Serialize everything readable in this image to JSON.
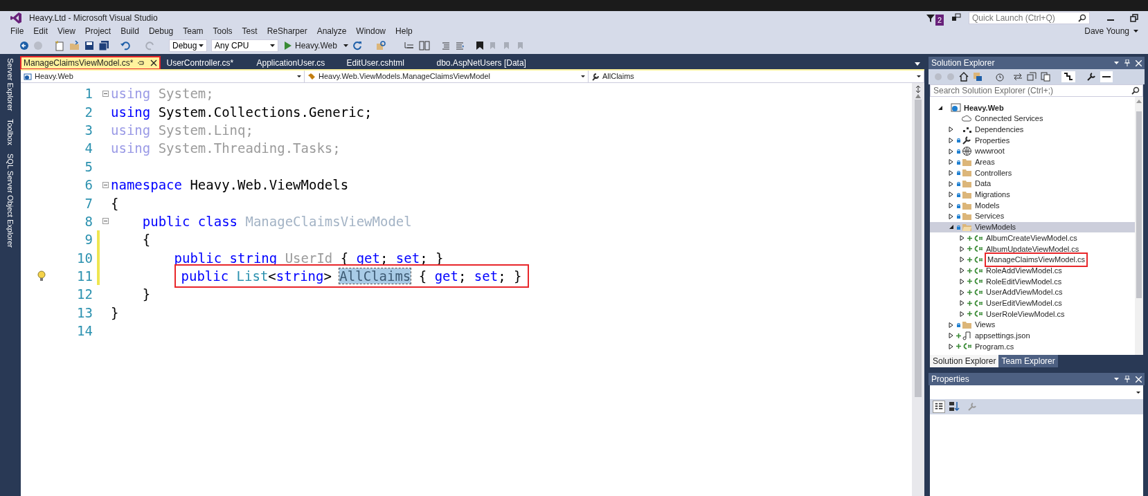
{
  "window": {
    "title": "Heavy.Ltd - Microsoft Visual Studio",
    "notification_count": "2",
    "quick_launch": {
      "placeholder": "Quick Launch (Ctrl+Q)"
    },
    "user": "Dave Young"
  },
  "menu": [
    "File",
    "Edit",
    "View",
    "Project",
    "Build",
    "Debug",
    "Team",
    "Tools",
    "Test",
    "ReSharper",
    "Analyze",
    "Window",
    "Help"
  ],
  "toolbar": {
    "configuration": "Debug",
    "platform": "Any CPU",
    "start": "Heavy.Web"
  },
  "side_tabs": [
    "Server Explorer",
    "Toolbox",
    "SQL Server Object Explorer"
  ],
  "tabs": [
    {
      "label": "ManageClaimsViewModel.cs*",
      "selected": true,
      "boxed": true
    },
    {
      "label": "UserController.cs*",
      "selected": false,
      "boxed": false
    },
    {
      "label": "ApplicationUser.cs",
      "selected": false,
      "boxed": false
    },
    {
      "label": "EditUser.cshtml",
      "selected": false,
      "boxed": false
    },
    {
      "label": "dbo.AspNetUsers [Data]",
      "selected": false,
      "boxed": false
    }
  ],
  "navigation": [
    "Heavy.Web",
    "Heavy.Web.ViewModels.ManageClaimsViewModel",
    "AllClaims"
  ],
  "code_lines": [
    {
      "number": "1",
      "collapsible": true,
      "changed": false,
      "lightbulb": false,
      "boxed": false,
      "tokens": [
        {
          "kind": "keyword-faded",
          "text": "using"
        },
        {
          "kind": "faded",
          "text": " System;"
        }
      ]
    },
    {
      "number": "2",
      "collapsible": false,
      "changed": false,
      "lightbulb": false,
      "boxed": false,
      "tokens": [
        {
          "kind": "keyword",
          "text": "using"
        },
        {
          "kind": "plain",
          "text": " System.Collections.Generic;"
        }
      ]
    },
    {
      "number": "3",
      "collapsible": false,
      "changed": false,
      "lightbulb": false,
      "boxed": false,
      "tokens": [
        {
          "kind": "keyword-faded",
          "text": "using"
        },
        {
          "kind": "faded",
          "text": " System.Linq;"
        }
      ]
    },
    {
      "number": "4",
      "collapsible": false,
      "changed": false,
      "lightbulb": false,
      "boxed": false,
      "tokens": [
        {
          "kind": "keyword-faded",
          "text": "using"
        },
        {
          "kind": "faded",
          "text": " System.Threading.Tasks;"
        }
      ]
    },
    {
      "number": "5",
      "collapsible": false,
      "changed": false,
      "lightbulb": false,
      "boxed": false
    },
    {
      "number": "6",
      "collapsible": true,
      "changed": false,
      "lightbulb": false,
      "boxed": false,
      "tokens": [
        {
          "kind": "keyword",
          "text": "namespace"
        },
        {
          "kind": "plain",
          "text": " Heavy.Web.ViewModels"
        }
      ]
    },
    {
      "number": "7",
      "collapsible": false,
      "changed": false,
      "lightbulb": false,
      "boxed": false,
      "tokens": [
        {
          "kind": "plain",
          "text": "{"
        }
      ]
    },
    {
      "number": "8",
      "collapsible": true,
      "changed": false,
      "lightbulb": false,
      "boxed": false,
      "tokens": [
        {
          "kind": "keyword",
          "text": "    public class "
        },
        {
          "kind": "type-faded",
          "text": "ManageClaimsViewModel"
        }
      ]
    },
    {
      "number": "9",
      "collapsible": false,
      "changed": true,
      "lightbulb": false,
      "boxed": false,
      "tokens": [
        {
          "kind": "plain",
          "text": "    {"
        }
      ]
    },
    {
      "number": "10",
      "collapsible": false,
      "changed": true,
      "lightbulb": false,
      "boxed": false,
      "tokens": [
        {
          "kind": "keyword",
          "text": "        public string "
        },
        {
          "kind": "faded",
          "text": "UserId"
        },
        {
          "kind": "plain",
          "text": " { "
        },
        {
          "kind": "keyword",
          "text": "get"
        },
        {
          "kind": "plain",
          "text": "; "
        },
        {
          "kind": "keyword",
          "text": "set"
        },
        {
          "kind": "plain",
          "text": "; }"
        }
      ]
    },
    {
      "number": "11",
      "collapsible": false,
      "changed": true,
      "lightbulb": true,
      "boxed": true,
      "tokens": [
        {
          "kind": "keyword",
          "text": "        public "
        },
        {
          "kind": "type",
          "text": "List"
        },
        {
          "kind": "plain",
          "text": "<"
        },
        {
          "kind": "keyword",
          "text": "string"
        },
        {
          "kind": "plain",
          "text": "> "
        },
        {
          "kind": "selected",
          "text": "AllClaims"
        },
        {
          "kind": "plain",
          "text": " { "
        },
        {
          "kind": "keyword",
          "text": "get"
        },
        {
          "kind": "plain",
          "text": "; "
        },
        {
          "kind": "keyword",
          "text": "set"
        },
        {
          "kind": "plain",
          "text": "; }"
        }
      ]
    },
    {
      "number": "12",
      "collapsible": false,
      "changed": false,
      "lightbulb": false,
      "boxed": false,
      "tokens": [
        {
          "kind": "plain",
          "text": "    }"
        }
      ]
    },
    {
      "number": "13",
      "collapsible": false,
      "changed": false,
      "lightbulb": false,
      "boxed": false,
      "tokens": [
        {
          "kind": "plain",
          "text": "}"
        }
      ]
    },
    {
      "number": "14",
      "collapsible": false,
      "changed": false,
      "lightbulb": false,
      "boxed": false
    }
  ],
  "solution_explorer": {
    "title": "Solution Explorer",
    "search": {
      "placeholder": "Search Solution Explorer (Ctrl+;)"
    },
    "tree": [
      {
        "label": "Heavy.Web",
        "kind": "project",
        "has_arrow": true,
        "expanded": true,
        "locked": false,
        "added": false,
        "selected": false,
        "boxed": false,
        "children": [
          {
            "label": "Connected Services",
            "kind": "cloud",
            "has_arrow": false,
            "locked": false,
            "added": false,
            "selected": false,
            "boxed": false
          },
          {
            "label": "Dependencies",
            "kind": "deps",
            "has_arrow": true,
            "expanded": false,
            "locked": false,
            "added": false,
            "selected": false,
            "boxed": false
          },
          {
            "label": "Properties",
            "kind": "wrench",
            "has_arrow": true,
            "expanded": false,
            "locked": true,
            "added": false,
            "selected": false,
            "boxed": false
          },
          {
            "label": "wwwroot",
            "kind": "globe",
            "has_arrow": true,
            "expanded": false,
            "locked": true,
            "added": false,
            "selected": false,
            "boxed": false
          },
          {
            "label": "Areas",
            "kind": "folder",
            "has_arrow": true,
            "expanded": false,
            "locked": true,
            "added": false,
            "selected": false,
            "boxed": false
          },
          {
            "label": "Controllers",
            "kind": "folder",
            "has_arrow": true,
            "expanded": false,
            "locked": true,
            "added": false,
            "selected": false,
            "boxed": false
          },
          {
            "label": "Data",
            "kind": "folder",
            "has_arrow": true,
            "expanded": false,
            "locked": true,
            "added": false,
            "selected": false,
            "boxed": false
          },
          {
            "label": "Migrations",
            "kind": "folder",
            "has_arrow": true,
            "expanded": false,
            "locked": true,
            "added": false,
            "selected": false,
            "boxed": false
          },
          {
            "label": "Models",
            "kind": "folder",
            "has_arrow": true,
            "expanded": false,
            "locked": true,
            "added": false,
            "selected": false,
            "boxed": false
          },
          {
            "label": "Services",
            "kind": "folder",
            "has_arrow": true,
            "expanded": false,
            "locked": true,
            "added": false,
            "selected": false,
            "boxed": false
          },
          {
            "label": "ViewModels",
            "kind": "folder-open",
            "has_arrow": true,
            "expanded": true,
            "locked": true,
            "added": false,
            "selected": true,
            "boxed": false,
            "children": [
              {
                "label": "AlbumCreateViewModel.cs",
                "kind": "csharp",
                "has_arrow": true,
                "expanded": false,
                "locked": false,
                "added": true,
                "selected": false,
                "boxed": false
              },
              {
                "label": "AlbumUpdateViewModel.cs",
                "kind": "csharp",
                "has_arrow": true,
                "expanded": false,
                "locked": false,
                "added": true,
                "selected": false,
                "boxed": false
              },
              {
                "label": "ManageClaimsViewModel.cs",
                "kind": "csharp",
                "has_arrow": true,
                "expanded": false,
                "locked": false,
                "added": true,
                "selected": false,
                "boxed": true
              },
              {
                "label": "RoleAddViewModel.cs",
                "kind": "csharp",
                "has_arrow": true,
                "expanded": false,
                "locked": false,
                "added": true,
                "selected": false,
                "boxed": false
              },
              {
                "label": "RoleEditViewModel.cs",
                "kind": "csharp",
                "has_arrow": true,
                "expanded": false,
                "locked": false,
                "added": true,
                "selected": false,
                "boxed": false
              },
              {
                "label": "UserAddViewModel.cs",
                "kind": "csharp",
                "has_arrow": true,
                "expanded": false,
                "locked": false,
                "added": true,
                "selected": false,
                "boxed": false
              },
              {
                "label": "UserEditViewModel.cs",
                "kind": "csharp",
                "has_arrow": true,
                "expanded": false,
                "locked": false,
                "added": true,
                "selected": false,
                "boxed": false
              },
              {
                "label": "UserRoleViewModel.cs",
                "kind": "csharp",
                "has_arrow": true,
                "expanded": false,
                "locked": false,
                "added": true,
                "selected": false,
                "boxed": false
              }
            ]
          },
          {
            "label": "Views",
            "kind": "folder",
            "has_arrow": true,
            "expanded": false,
            "locked": true,
            "added": false,
            "selected": false,
            "boxed": false
          },
          {
            "label": "appsettings.json",
            "kind": "json",
            "has_arrow": true,
            "expanded": false,
            "locked": false,
            "added": true,
            "selected": false,
            "boxed": false
          },
          {
            "label": "Program.cs",
            "kind": "csharp",
            "has_arrow": true,
            "expanded": false,
            "locked": false,
            "added": true,
            "selected": false,
            "boxed": false
          }
        ]
      }
    ],
    "bottom_tabs": [
      {
        "label": "Solution Explorer",
        "selected": true
      },
      {
        "label": "Team Explorer",
        "selected": false
      }
    ]
  },
  "properties": {
    "title": "Properties"
  }
}
